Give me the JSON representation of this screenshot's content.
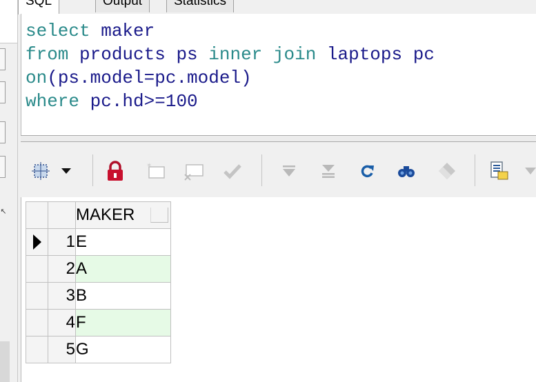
{
  "tabs": [
    {
      "label": "SQL",
      "active": true
    },
    {
      "label": "Output",
      "active": false
    },
    {
      "label": "Statistics",
      "active": false
    }
  ],
  "editor": {
    "lines": [
      [
        {
          "t": "select",
          "c": "kw"
        },
        {
          "t": " maker",
          "c": "id"
        }
      ],
      [
        {
          "t": "from",
          "c": "kw"
        },
        {
          "t": " products ps ",
          "c": "id"
        },
        {
          "t": "inner join",
          "c": "kw"
        },
        {
          "t": " laptops pc",
          "c": "id"
        }
      ],
      [
        {
          "t": "on",
          "c": "kw"
        },
        {
          "t": "(ps.model=pc.model)",
          "c": "id"
        }
      ],
      [
        {
          "t": "where",
          "c": "kw"
        },
        {
          "t": " pc.hd>=100",
          "c": "id"
        }
      ]
    ]
  },
  "toolbar": {
    "icons": [
      "grid-select-icon",
      "dropdown-arrow-icon",
      "lock-icon",
      "new-record-icon",
      "delete-record-icon",
      "post-icon",
      "prior-icon",
      "next-icon",
      "refresh-icon",
      "find-icon",
      "eraser-icon",
      "export-icon"
    ]
  },
  "results": {
    "column": "MAKER",
    "rows": [
      {
        "n": "1",
        "v": "E",
        "current": true
      },
      {
        "n": "2",
        "v": "A",
        "current": false
      },
      {
        "n": "3",
        "v": "B",
        "current": false
      },
      {
        "n": "4",
        "v": "F",
        "current": false
      },
      {
        "n": "5",
        "v": "G",
        "current": false
      }
    ]
  },
  "colors": {
    "keyword": "#2a8a8a",
    "identifier": "#1a1a8a",
    "alt_row": "#e6fae6"
  }
}
